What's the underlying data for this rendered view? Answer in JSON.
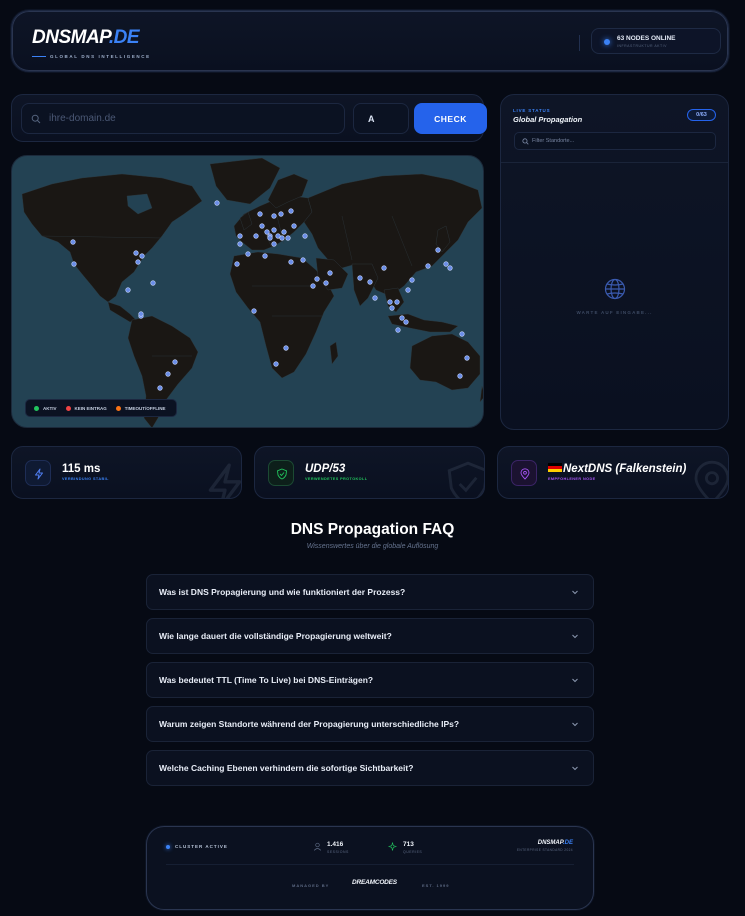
{
  "header": {
    "logo_main": "DNSMAP",
    "logo_tld": ".DE",
    "logo_tagline": "GLOBAL DNS INTELLIGENCE",
    "nodes_status": "63 NODES ONLINE",
    "nodes_sub": "INFRASTRUKTUR AKTIV"
  },
  "search": {
    "placeholder": "ihre-domain.de",
    "value": "",
    "record_type": "A",
    "check_label": "CHECK"
  },
  "map": {
    "legend": [
      {
        "label": "AKTIV",
        "color": "#22c55e"
      },
      {
        "label": "KEIN EINTRAG",
        "color": "#ef4444"
      },
      {
        "label": "TIMEOUT/OFFLINE",
        "color": "#f97316"
      }
    ]
  },
  "live": {
    "label": "LIVE STATUS",
    "title": "Global Propagation",
    "count": "0/63",
    "filter_placeholder": "Filter Standorte...",
    "waiting_text": "WARTE AUF EINGABE..."
  },
  "stats": [
    {
      "value": "115 ms",
      "sub": "VERBINDUNG STABIL",
      "icon": "lightning-icon",
      "accent": "#3b82f6"
    },
    {
      "value": "UDP/53",
      "sub": "VERWENDETES PROTOKOLL",
      "icon": "shield-check-icon",
      "accent": "#22c55e"
    },
    {
      "value": "NextDNS (Falkenstein)",
      "sub": "EMPFOHLENER NODE",
      "icon": "location-pin-icon",
      "accent": "#a855f7"
    }
  ],
  "faq": {
    "title": "DNS Propagation FAQ",
    "subtitle": "Wissenswertes über die globale Auflösung",
    "items": [
      "Was ist DNS Propagierung und wie funktioniert der Prozess?",
      "Wie lange dauert die vollständige Propagierung weltweit?",
      "Was bedeutet TTL (Time To Live) bei DNS-Einträgen?",
      "Warum zeigen Standorte während der Propagierung unterschiedliche IPs?",
      "Welche Caching Ebenen verhindern die sofortige Sichtbarkeit?"
    ]
  },
  "footer": {
    "cluster": "CLUSTER ACTIVE",
    "sessions_value": "1.416",
    "sessions_label": "SESSIONS",
    "queries_value": "713",
    "queries_label": "QUERIES",
    "brand_main": "DNSMAP",
    "brand_tld": ".DE",
    "brand_sub": "ENTERPRISE STANDARD 2024",
    "managed_by": "MANAGED BY",
    "company": "DREAMCODES",
    "est": "EST. 1999"
  },
  "colors": {
    "accent": "#2563eb",
    "background": "#060a14",
    "map_ocean": "#234253",
    "land": "#1a1714"
  }
}
